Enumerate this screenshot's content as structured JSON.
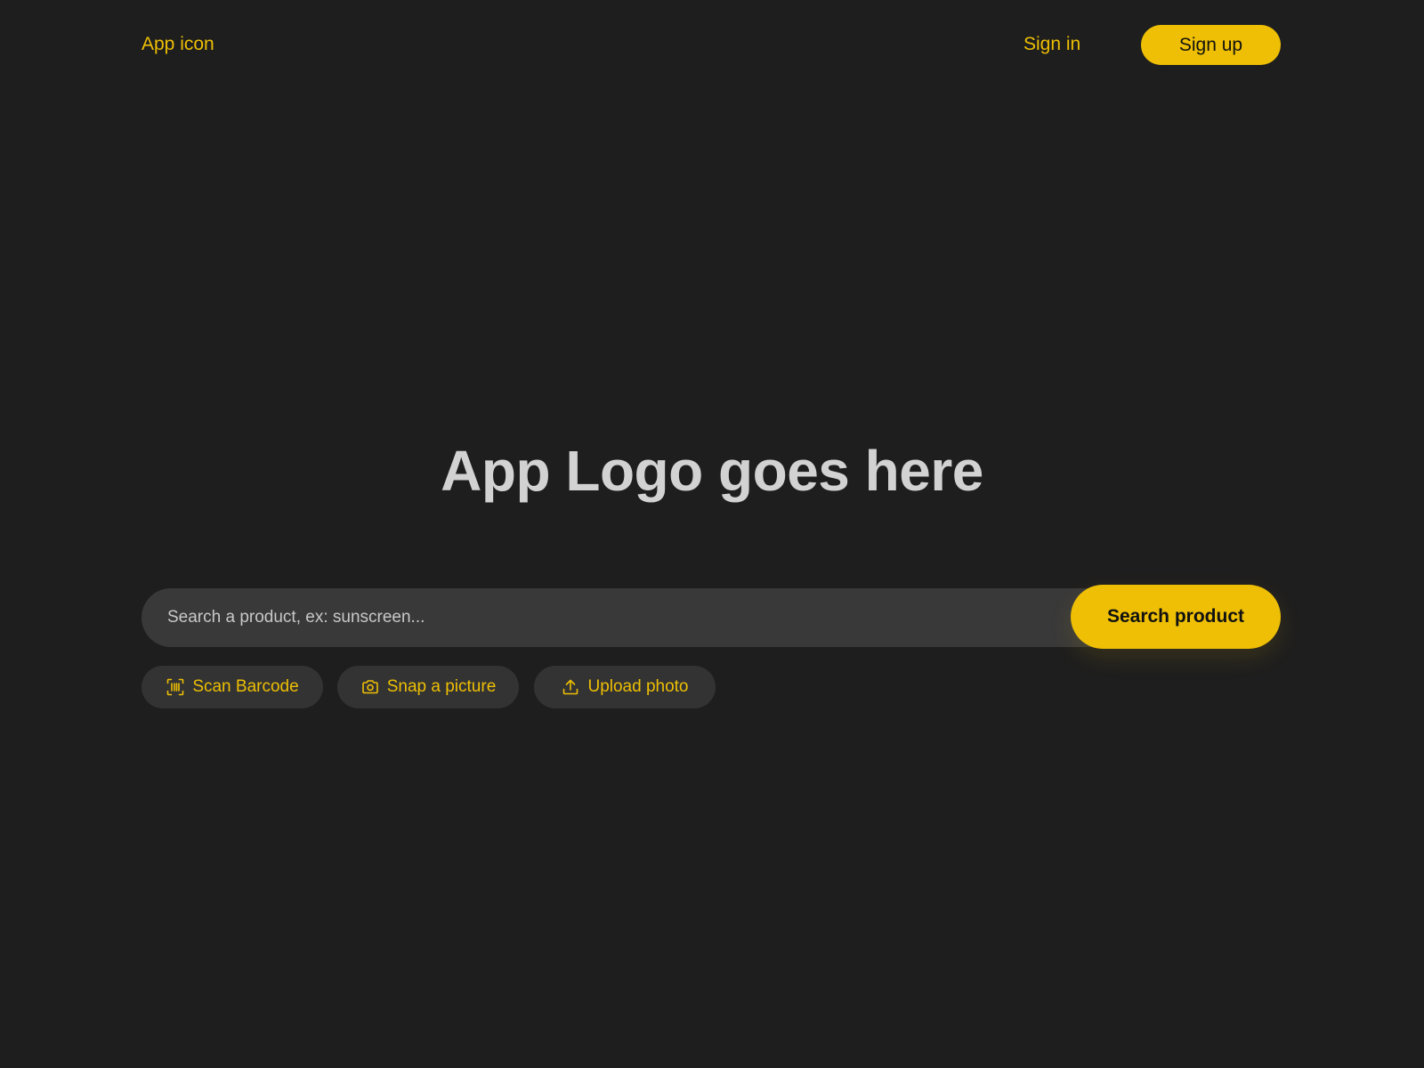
{
  "header": {
    "app_icon_label": "App icon",
    "sign_in_label": "Sign in",
    "sign_up_label": "Sign up"
  },
  "hero": {
    "title": "App Logo goes here"
  },
  "search": {
    "placeholder": "Search a product, ex: sunscreen...",
    "value": "",
    "button_label": "Search product"
  },
  "actions": [
    {
      "label": "Scan Barcode",
      "icon": "barcode-scan-icon"
    },
    {
      "label": "Snap a picture",
      "icon": "camera-icon"
    },
    {
      "label": "Upload photo",
      "icon": "upload-icon"
    }
  ],
  "colors": {
    "background": "#1e1e1e",
    "accent": "#eebf04",
    "surface": "#393939",
    "chip": "#333333",
    "title_text": "#d2d2d2"
  }
}
